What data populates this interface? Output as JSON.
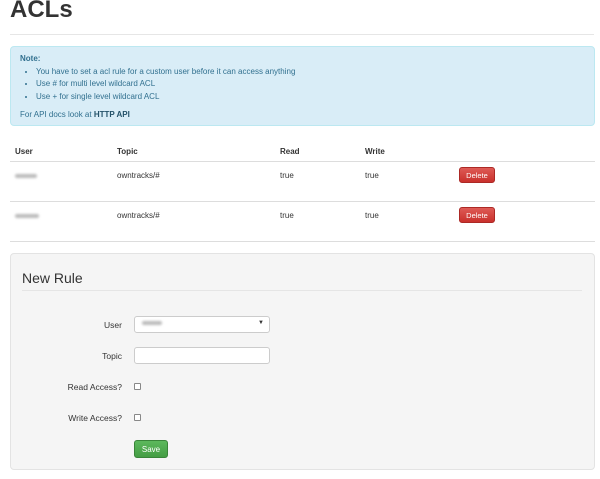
{
  "page": {
    "title": "ACLs"
  },
  "note": {
    "heading": "Note:",
    "items": [
      "You have to set a acl rule for a custom user before it can access anything",
      "Use # for multi level wildcard ACL",
      "Use + for single level wildcard ACL"
    ],
    "api_prefix": "For API docs look at",
    "api_link": "HTTP API"
  },
  "table": {
    "headers": {
      "user": "User",
      "topic": "Topic",
      "read": "Read",
      "write": "Write"
    },
    "rows": [
      {
        "user": "",
        "topic": "owntracks/#",
        "read": "true",
        "write": "true",
        "delete_label": "Delete"
      },
      {
        "user": "",
        "topic": "owntracks/#",
        "read": "true",
        "write": "true",
        "delete_label": "Delete"
      }
    ]
  },
  "new_rule": {
    "title": "New Rule",
    "user_label": "User",
    "user_value": "",
    "topic_label": "Topic",
    "topic_value": "",
    "read_label": "Read Access?",
    "read_checked": false,
    "write_label": "Write Access?",
    "write_checked": false,
    "save_label": "Save"
  },
  "colors": {
    "note_bg": "#d9edf7",
    "note_text": "#31708f",
    "delete_button": "#d9534f",
    "save_button": "#5cb85c",
    "well_bg": "#f5f5f5"
  }
}
